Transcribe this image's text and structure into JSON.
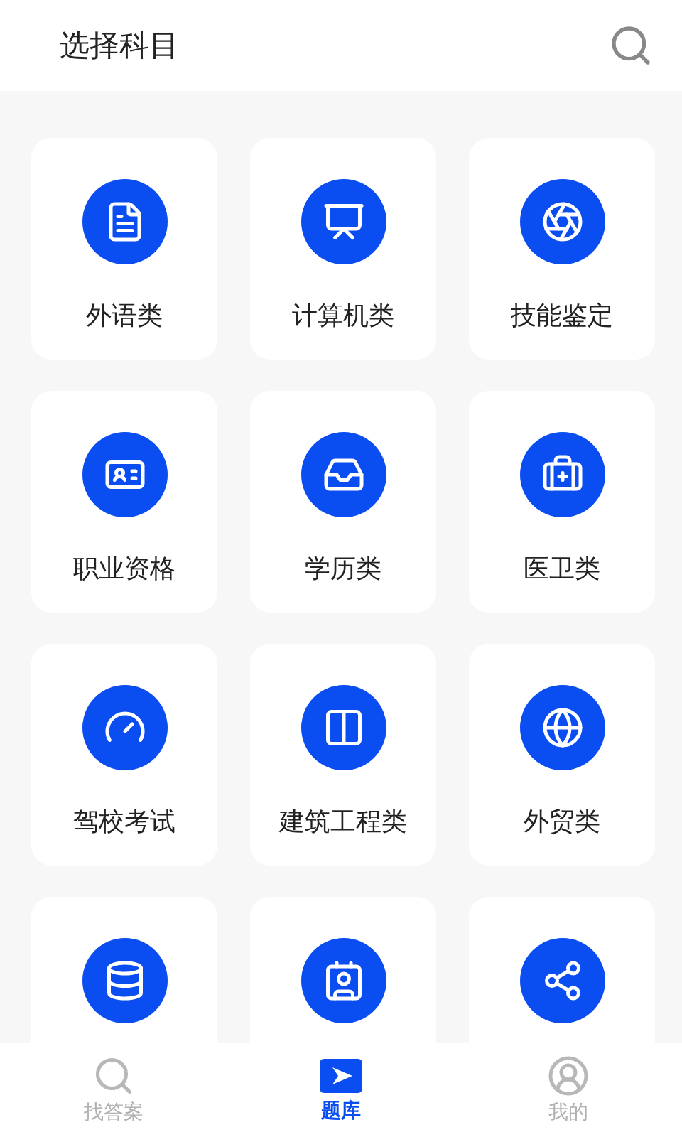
{
  "header": {
    "title": "选择科目"
  },
  "categories": [
    {
      "kind": "labeled",
      "label": "外语类"
    },
    {
      "kind": "labeled",
      "label": "计算机类"
    },
    {
      "kind": "labeled",
      "label": "技能鉴定"
    },
    {
      "kind": "labeled",
      "label": "职业资格"
    },
    {
      "kind": "labeled",
      "label": "学历类"
    },
    {
      "kind": "labeled",
      "label": "医卫类"
    },
    {
      "kind": "labeled",
      "label": "驾校考试"
    },
    {
      "kind": "labeled",
      "label": "建筑工程类"
    },
    {
      "kind": "labeled",
      "label": "外贸类"
    },
    {
      "kind": "cut_off"
    },
    {
      "kind": "cut_off"
    },
    {
      "kind": "cut_off"
    }
  ],
  "tab_bar": [
    {
      "label": "找答案",
      "selected": false
    },
    {
      "label": "题库",
      "selected": true
    },
    {
      "label": "我的",
      "selected": false
    }
  ]
}
